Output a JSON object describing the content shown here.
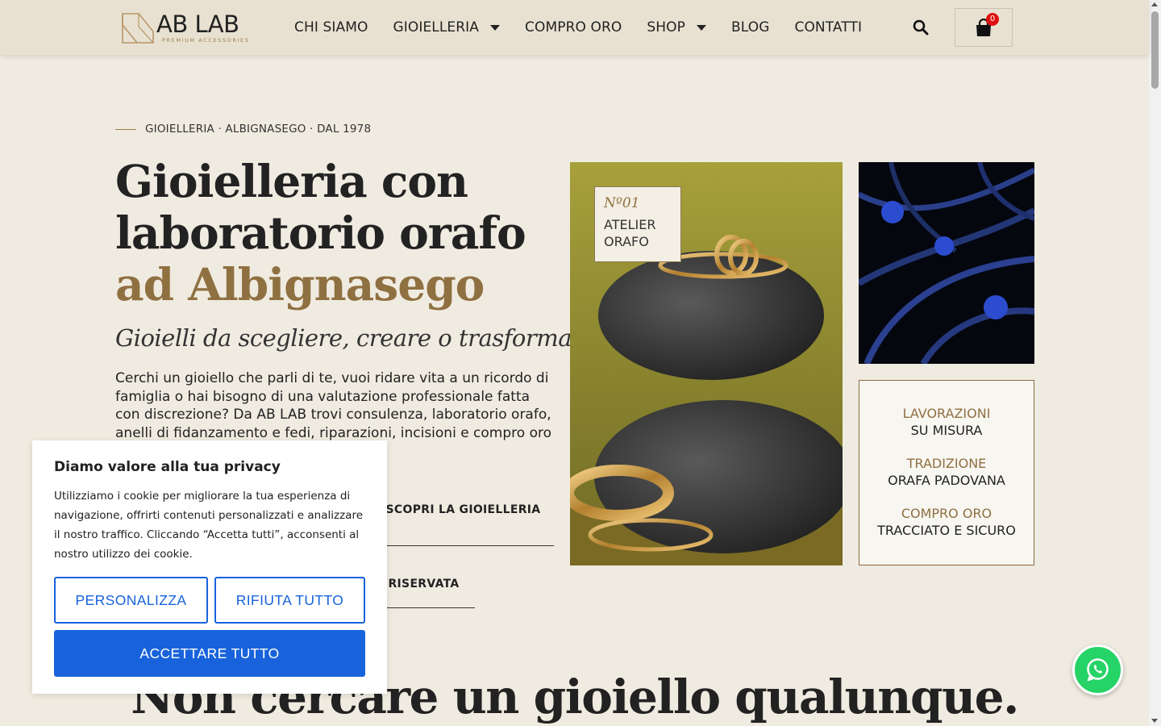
{
  "brand": {
    "name": "AB LAB",
    "tagline": "PREMIUM ACCESSORIES"
  },
  "nav": {
    "items": [
      {
        "label": "CHI SIAMO",
        "dropdown": false
      },
      {
        "label": "GIOIELLERIA",
        "dropdown": true
      },
      {
        "label": "COMPRO ORO",
        "dropdown": false
      },
      {
        "label": "SHOP",
        "dropdown": true
      },
      {
        "label": "BLOG",
        "dropdown": false
      },
      {
        "label": "CONTATTI",
        "dropdown": false
      }
    ],
    "cart_count": "0",
    "icons": [
      "search-icon",
      "cart-icon"
    ]
  },
  "hero": {
    "eyebrow": "GIOIELLERIA · ALBIGNASEGO · DAL 1978",
    "title_part1": "Gioielleria con laboratorio orafo ",
    "title_part2": "ad Albignasego",
    "subtitle": "Gioielli da scegliere, creare o trasformare.",
    "intro": "Cerchi un gioiello che parli di te, vuoi ridare vita a un ricordo di famiglia o hai bisogno di una valutazione professionale fatta con discrezione? Da AB LAB trovi consulenza, laboratorio orafo, anelli di fidanzamento e fedi, riparazioni, incisioni e compro oro con un",
    "cta_primary": "SCOPRI LA GIOIELLERIA",
    "cta_secondary": "RISERVATA",
    "atelier_no": "Nº01",
    "atelier_label": "ATELIER ORAFO",
    "features": [
      {
        "a": "LAVORAZIONI",
        "b": "SU MISURA"
      },
      {
        "a": "TRADIZIONE",
        "b": "ORAFA PADOVANA"
      },
      {
        "a": "COMPRO ORO",
        "b": "TRACCIATO E SICURO"
      }
    ]
  },
  "section2": {
    "title": "Non cercare un gioiello qualunque."
  },
  "cookie": {
    "title": "Diamo valore alla tua privacy",
    "text": "Utilizziamo i cookie per migliorare la tua esperienza di navigazione, offrirti contenuti personalizzati e analizzare il nostro traffico. Cliccando “Accetta tutti”, acconsenti al nostro utilizzo dei cookie.",
    "btn_customize": "PERSONALIZZA",
    "btn_reject": "RIFIUTA TUTTO",
    "btn_accept": "ACCETTARE TUTTO"
  },
  "colors": {
    "background": "#f0ebe0",
    "header": "#e8e1d1",
    "gold": "#8f7041",
    "cookie_blue": "#1863dc",
    "whatsapp": "#25d366"
  }
}
